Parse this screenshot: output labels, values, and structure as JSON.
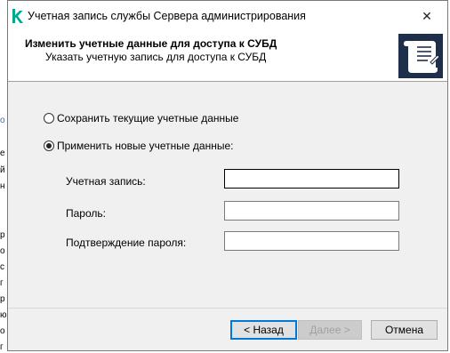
{
  "background_window": {
    "glyphs": [
      "о",
      "е",
      "й",
      "н",
      "р",
      "о",
      "с",
      "г",
      "р",
      "ю",
      "о",
      "г"
    ]
  },
  "window": {
    "title": "Учетная запись службы Сервера администрирования",
    "close_glyph": "✕"
  },
  "header": {
    "title": "Изменить учетные данные для доступа к СУБД",
    "subtitle": "Указать учетную запись для доступа к СУБД"
  },
  "options": {
    "keep_current": "Сохранить текущие учетные данные",
    "apply_new": "Применить новые учетные данные:",
    "selected": "apply_new"
  },
  "fields": {
    "account_label": "Учетная запись:",
    "account_value": "",
    "password_label": "Пароль:",
    "password_value": "",
    "confirm_label": "Подтверждение пароля:",
    "confirm_value": ""
  },
  "buttons": {
    "back": "< Назад",
    "next": "Далее >",
    "cancel": "Отмена"
  },
  "colors": {
    "brand_green": "#00a88e",
    "focus_blue": "#0078d7"
  }
}
